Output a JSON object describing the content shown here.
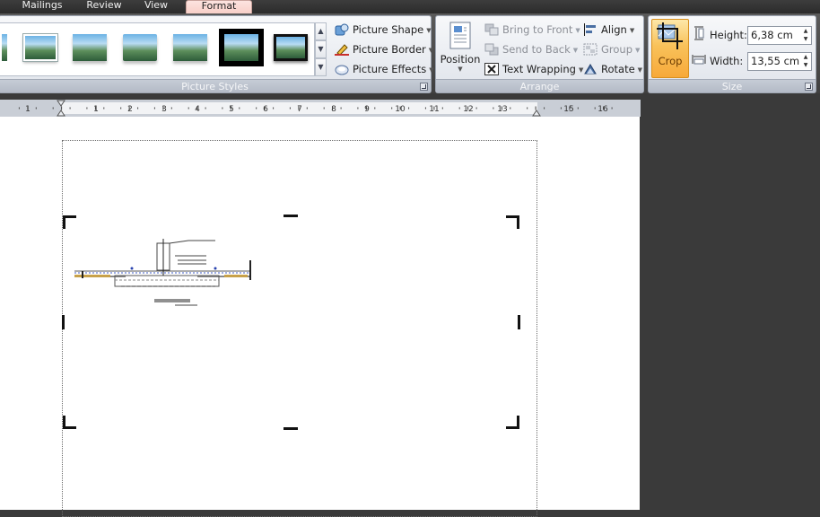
{
  "tabs": [
    {
      "label": "Mailings",
      "active": false
    },
    {
      "label": "Review",
      "active": false
    },
    {
      "label": "View",
      "active": false
    },
    {
      "label": "Format",
      "active": true
    }
  ],
  "picture_styles": {
    "group_label": "Picture Styles",
    "commands": {
      "shape": "Picture Shape",
      "border": "Picture Border",
      "effects": "Picture Effects"
    }
  },
  "arrange": {
    "group_label": "Arrange",
    "position_label": "Position",
    "bring_to_front": "Bring to Front",
    "send_to_back": "Send to Back",
    "text_wrapping": "Text Wrapping",
    "align": "Align",
    "group": "Group",
    "rotate": "Rotate"
  },
  "size": {
    "group_label": "Size",
    "crop_label": "Crop",
    "height_label": "Height:",
    "height_value": "6,38 cm",
    "width_label": "Width:",
    "width_value": "13,55 cm"
  },
  "ruler": {
    "numbers": [
      "1",
      "1",
      "2",
      "3",
      "4",
      "5",
      "6",
      "7",
      "8",
      "9",
      "10",
      "11",
      "12",
      "13",
      "15",
      "16"
    ]
  },
  "colors": {
    "active_tab": "#f8cfc8",
    "crop_highlight": "#f7b64b",
    "ribbon_dark": "#404040",
    "workspace": "#3a3a3a"
  }
}
